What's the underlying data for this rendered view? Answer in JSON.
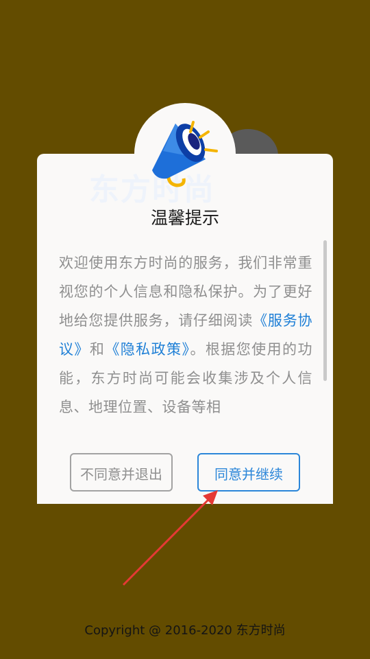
{
  "dialog": {
    "title": "温馨提示",
    "watermark": "东方时尚",
    "body_intro": "欢迎使用东方时尚的服务，我们非常重视您的个人信息和隐私保护。为了更好地给您提供服务，请仔细阅读",
    "link_service": "《服务协议》",
    "conjunction": "和",
    "link_privacy": "《隐私政策》",
    "body_rest": "。根据您使用的功能，东方时尚可能会收集涉及个人信息、地理位置、设备等相",
    "decline_label": "不同意并退出",
    "accept_label": "同意并继续"
  },
  "icons": {
    "header": "megaphone-icon",
    "annotation": "red-arrow"
  },
  "footer": {
    "copyright": "Copyright @ 2016-2020 东方时尚"
  },
  "colors": {
    "background": "#634c00",
    "dialog": "#faf9f8",
    "accent": "#2b86d9",
    "annotation": "#e53935"
  }
}
